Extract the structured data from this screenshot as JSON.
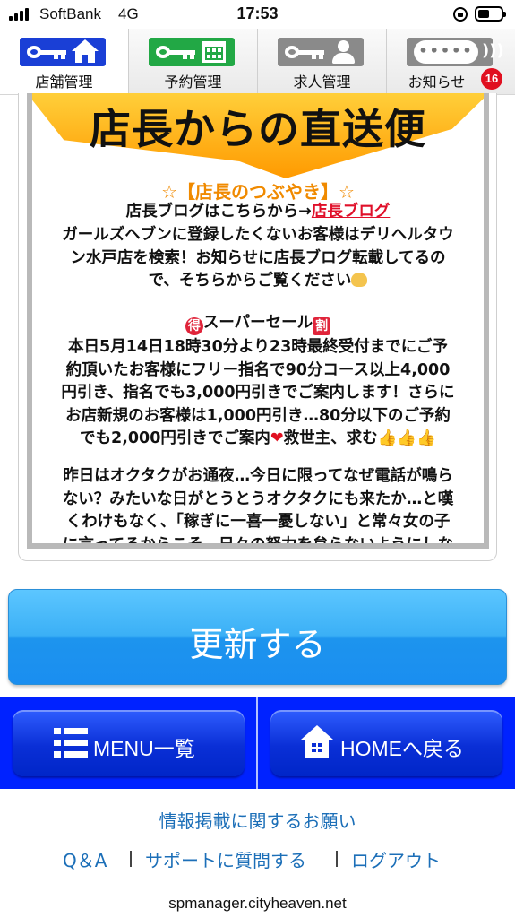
{
  "status_bar": {
    "carrier": "SoftBank",
    "network": "4G",
    "time": "17:53"
  },
  "tabs": [
    {
      "label": "店舗管理",
      "icon": "key-home-icon",
      "color": "#1a3fd6",
      "active": true
    },
    {
      "label": "予約管理",
      "icon": "key-calendar-icon",
      "color": "#22a845",
      "active": false
    },
    {
      "label": "求人管理",
      "icon": "key-person-icon",
      "color": "#8a8a8a",
      "active": false
    },
    {
      "label": "お知らせ",
      "icon": "speech-bubble-icon",
      "color": "#8a8a8a",
      "active": false,
      "badge": "16"
    }
  ],
  "post": {
    "banner_title": "店長からの直送便",
    "heading": "☆【店長のつぶやき】☆",
    "blog_prefix": "店長ブログはこちらから→",
    "blog_link": "店長ブログ",
    "para1_lines": [
      "ガールズヘブンに登録したくないお客様はデリヘルタウ",
      "ン水戸店を検索！お知らせに店長ブログ転載してるの",
      "で、そちらからご覧ください"
    ],
    "sale_mark_left": "得",
    "sale_title": "スーパーセール",
    "sale_mark_right": "割",
    "para2_lines": [
      "本日5月14日18時30分より23時最終受付までにご予",
      "約頂いたお客様にフリー指名で90分コース以上4,000",
      "円引き、指名でも3,000円引きでご案内します！さらに",
      "お店新規のお客様は1,000円引き…80分以下のご予約",
      "でも2,000円引きでご案内"
    ],
    "para2_tail": "救世主、求む",
    "para3_lines": [
      "昨日はオクタクがお通夜…今日に限ってなぜ電話が鳴ら",
      "ない？みたいな日がとうとうオクタクにも来たか…と嘆",
      "くわけもなく、「稼ぎに一喜一憂しない」と常々女の子",
      "に言ってるからこそ、日々の努力を怠らないようにしな"
    ]
  },
  "update_button": {
    "label": "更新する"
  },
  "nav": {
    "menu_label": "MENU一覧",
    "home_label": "HOMEへ戻る"
  },
  "footer": {
    "request_link": "情報掲載に関するお願い",
    "qa_link": "Q＆A",
    "support_link": "サポートに質問する",
    "logout_link": "ログアウト",
    "domain": "spmanager.cityheaven.net"
  }
}
